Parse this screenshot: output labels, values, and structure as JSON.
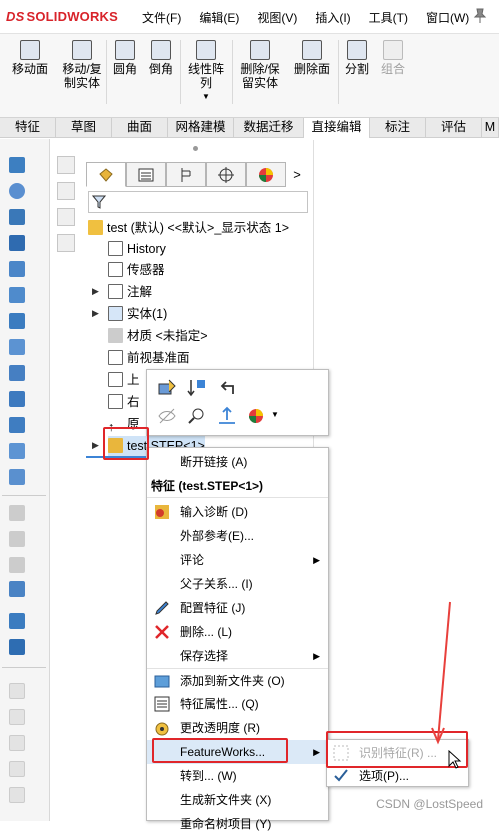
{
  "app": {
    "logo_text": "SOLIDWORKS",
    "logo_mark": "DS"
  },
  "menu": [
    "文件(F)",
    "编辑(E)",
    "视图(V)",
    "插入(I)",
    "工具(T)",
    "窗口(W)"
  ],
  "ribbon": {
    "move_face": "移动面",
    "move_copy": "移动/复制实体",
    "fillet": "圆角",
    "chamfer": "倒角",
    "linear_pattern": "线性阵列",
    "delete_keep": "删除/保留实体",
    "delete_face": "删除面",
    "split": "分割",
    "combine": "组合"
  },
  "tabs": [
    "特征",
    "草图",
    "曲面",
    "网格建模",
    "数据迁移",
    "直接编辑",
    "标注",
    "评估",
    "M"
  ],
  "tree": {
    "root": "test (默认) <<默认>_显示状态 1>",
    "history": "History",
    "sensors": "传感器",
    "annotations": "注解",
    "solid_bodies": "实体(1)",
    "material": "材质 <未指定>",
    "front_plane": "前视基准面",
    "top_plane": "上",
    "right_plane": "右",
    "origin": "原",
    "step_feature": "test.STEP<1>"
  },
  "context_menu": {
    "break_link": "断开链接 (A)",
    "header": "特征 (test.STEP<1>)",
    "import_diagnostics": "输入诊断 (D)",
    "external_refs": "外部参考(E)...",
    "comment": "评论",
    "parent_child": "父子关系... (I)",
    "configure_feature": "配置特征 (J)",
    "delete": "删除... (L)",
    "save_selection": "保存选择",
    "add_folder": "添加到新文件夹 (O)",
    "feature_props": "特征属性... (Q)",
    "change_transparency": "更改透明度 (R)",
    "featureworks": "FeatureWorks...",
    "goto": "转到... (W)",
    "new_folder": "生成新文件夹 (X)",
    "rename_tree_item": "重命名树项目 (Y)"
  },
  "submenu": {
    "recognize": "识别特征(R) ...",
    "options": "选项(P)..."
  },
  "watermark": "CSDN @LostSpeed",
  "colors": {
    "accent_red": "#e0262a",
    "logo_red": "#d8232a"
  }
}
